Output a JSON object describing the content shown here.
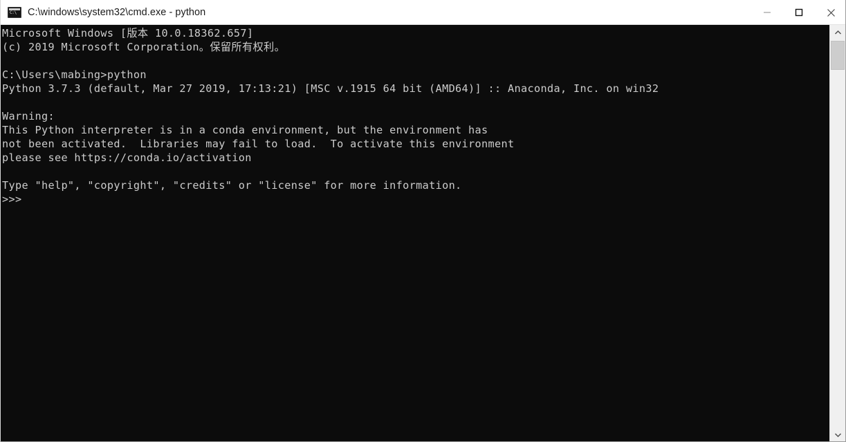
{
  "window": {
    "title": "C:\\windows\\system32\\cmd.exe - python",
    "icon": "cmd-console-icon",
    "background_color": "#0c0c0c",
    "titlebar_color": "#ffffff",
    "text_color": "#cccccc"
  },
  "window_controls": {
    "minimize_label": "Minimize",
    "maximize_label": "Maximize",
    "close_label": "Close"
  },
  "terminal": {
    "lines": [
      "Microsoft Windows [版本 10.0.18362.657]",
      "(c) 2019 Microsoft Corporation。保留所有权利。",
      "",
      "C:\\Users\\mabing>python",
      "Python 3.7.3 (default, Mar 27 2019, 17:13:21) [MSC v.1915 64 bit (AMD64)] :: Anaconda, Inc. on win32",
      "",
      "Warning:",
      "This Python interpreter is in a conda environment, but the environment has",
      "not been activated.  Libraries may fail to load.  To activate this environment",
      "please see https://conda.io/activation",
      "",
      "Type \"help\", \"copyright\", \"credits\" or \"license\" for more information.",
      ">>>"
    ],
    "prompt": ">>>",
    "current_directory": "C:\\Users\\mabing",
    "command_entered": "python",
    "python_version": "3.7.3",
    "distribution": "Anaconda, Inc.",
    "platform": "win32",
    "os_version": "10.0.18362.657"
  },
  "scrollbar": {
    "up_arrow": "chevron-up-icon",
    "down_arrow": "chevron-down-icon",
    "orientation": "vertical"
  }
}
